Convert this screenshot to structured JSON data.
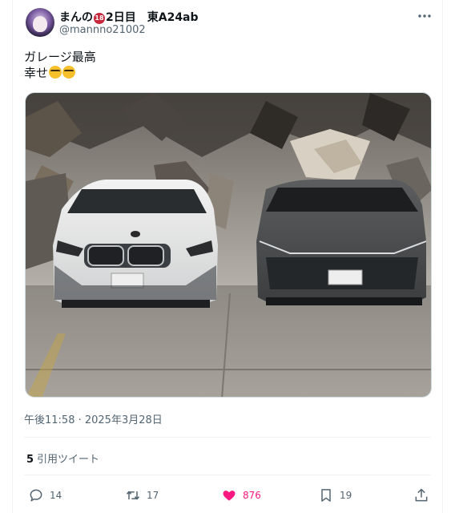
{
  "author": {
    "display_name_prefix": "まんの",
    "age_badge": "18",
    "display_name_suffix": "2日目　東A24ab",
    "handle": "@mannno21002"
  },
  "tweet": {
    "text_line1": "ガレージ最高",
    "text_line2": "幸せ"
  },
  "media": {
    "left_plate": "",
    "right_plate": ""
  },
  "meta": {
    "timestamp": "午後11:58 · 2025年3月28日"
  },
  "quotes": {
    "count": "5",
    "label": "引用ツイート"
  },
  "actions": {
    "replies": "14",
    "retweets": "17",
    "likes": "876",
    "bookmarks": "19"
  },
  "colors": {
    "like_accent": "#f91880",
    "muted_text": "#536471",
    "badge_red": "#c6283c"
  }
}
